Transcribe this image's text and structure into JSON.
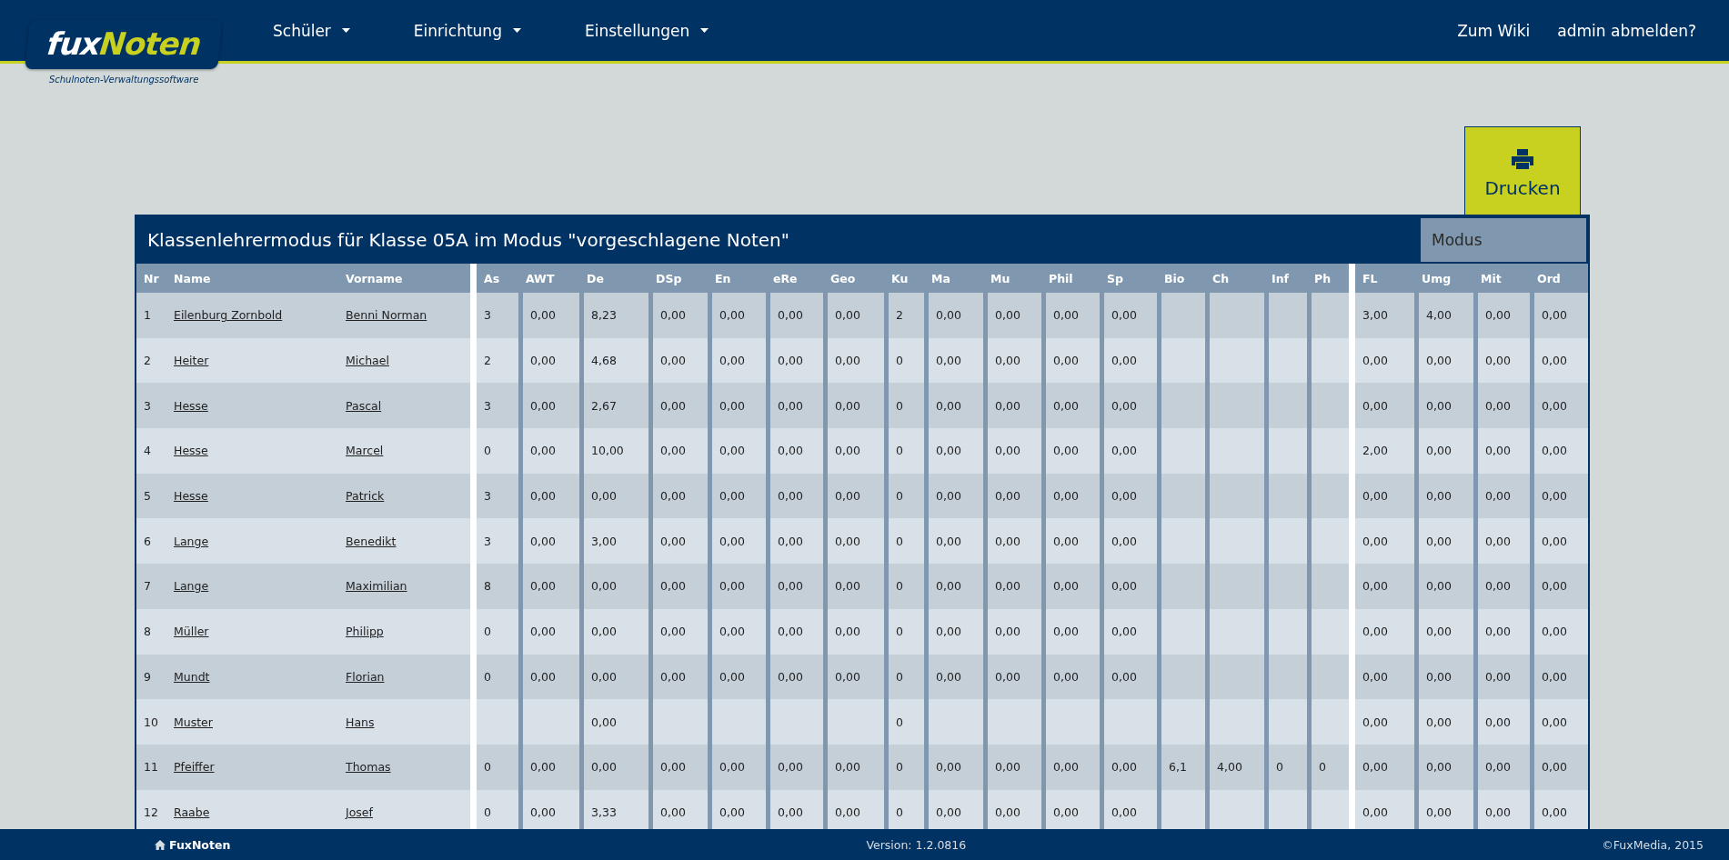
{
  "header": {
    "logo": {
      "part_1": "fux",
      "part_2": "Noten",
      "tagline": "Schulnoten-Verwaltungssoftware"
    },
    "nav": [
      {
        "label": "Schüler"
      },
      {
        "label": "Einrichtung"
      },
      {
        "label": "Einstellungen"
      }
    ],
    "links": [
      {
        "label": "Zum Wiki"
      },
      {
        "label": "admin abmelden?"
      }
    ]
  },
  "print_button": {
    "label": "Drucken"
  },
  "table": {
    "title": "Klassenlehrermodus für Klasse 05A im Modus \"vorgeschlagene Noten\"",
    "mode_dropdown": "Modus",
    "columns": {
      "student": [
        "Nr",
        "Name",
        "Vorname"
      ],
      "subjects": [
        "As",
        "AWT",
        "De",
        "DSp",
        "En",
        "eRe",
        "Geo",
        "Ku",
        "Ma",
        "Mu",
        "Phil",
        "Sp",
        "Bio",
        "Ch",
        "Inf",
        "Ph"
      ],
      "conduct": [
        "FL",
        "Umg",
        "Mit",
        "Ord"
      ]
    },
    "rows": [
      {
        "nr": "1",
        "name": "Eilenburg Zornbold",
        "first_name": "Benni Norman",
        "subjects": [
          {
            "kind": "grade",
            "value": "3"
          },
          {
            "kind": "grade",
            "value": "0,00"
          },
          {
            "kind": "grade",
            "value": "8,23"
          },
          {
            "kind": "grade",
            "value": "0,00"
          },
          {
            "kind": "grade",
            "value": "0,00"
          },
          {
            "kind": "grade",
            "value": "0,00"
          },
          {
            "kind": "grade",
            "value": "0,00"
          },
          {
            "kind": "grade",
            "value": "2"
          },
          {
            "kind": "grade",
            "value": "0,00"
          },
          {
            "kind": "grade",
            "value": "0,00"
          },
          {
            "kind": "grade",
            "value": "0,00"
          },
          {
            "kind": "grade",
            "value": "0,00"
          },
          {
            "kind": "empty"
          },
          {
            "kind": "empty"
          },
          {
            "kind": "empty"
          },
          {
            "kind": "empty"
          }
        ],
        "conduct": [
          {
            "kind": "grade",
            "value": "3,00"
          },
          {
            "kind": "grade",
            "value": "4,00"
          },
          {
            "kind": "grade",
            "value": "0,00"
          },
          {
            "kind": "grade",
            "value": "0,00"
          }
        ]
      },
      {
        "nr": "2",
        "name": "Heiter",
        "first_name": "Michael",
        "subjects": [
          {
            "kind": "grade",
            "value": "2"
          },
          {
            "kind": "grade",
            "value": "0,00"
          },
          {
            "kind": "grade",
            "value": "4,68"
          },
          {
            "kind": "grade",
            "value": "0,00"
          },
          {
            "kind": "grade",
            "value": "0,00"
          },
          {
            "kind": "grade",
            "value": "0,00"
          },
          {
            "kind": "grade",
            "value": "0,00"
          },
          {
            "kind": "grade",
            "value": "0"
          },
          {
            "kind": "grade",
            "value": "0,00"
          },
          {
            "kind": "grade",
            "value": "0,00"
          },
          {
            "kind": "grade",
            "value": "0,00"
          },
          {
            "kind": "grade",
            "value": "0,00"
          },
          {
            "kind": "empty"
          },
          {
            "kind": "empty"
          },
          {
            "kind": "empty"
          },
          {
            "kind": "empty"
          }
        ],
        "conduct": [
          {
            "kind": "grade",
            "value": "0,00"
          },
          {
            "kind": "grade",
            "value": "0,00"
          },
          {
            "kind": "grade",
            "value": "0,00"
          },
          {
            "kind": "grade",
            "value": "0,00"
          }
        ]
      },
      {
        "nr": "3",
        "name": "Hesse",
        "first_name": "Pascal",
        "subjects": [
          {
            "kind": "grade",
            "value": "3"
          },
          {
            "kind": "grade",
            "value": "0,00"
          },
          {
            "kind": "grade",
            "value": "2,67"
          },
          {
            "kind": "grade",
            "value": "0,00"
          },
          {
            "kind": "grade",
            "value": "0,00"
          },
          {
            "kind": "grade",
            "value": "0,00"
          },
          {
            "kind": "grade",
            "value": "0,00"
          },
          {
            "kind": "grade",
            "value": "0"
          },
          {
            "kind": "grade",
            "value": "0,00"
          },
          {
            "kind": "grade",
            "value": "0,00"
          },
          {
            "kind": "grade",
            "value": "0,00"
          },
          {
            "kind": "grade",
            "value": "0,00"
          },
          {
            "kind": "empty"
          },
          {
            "kind": "empty"
          },
          {
            "kind": "empty"
          },
          {
            "kind": "empty"
          }
        ],
        "conduct": [
          {
            "kind": "grade",
            "value": "0,00"
          },
          {
            "kind": "grade",
            "value": "0,00"
          },
          {
            "kind": "grade",
            "value": "0,00"
          },
          {
            "kind": "grade",
            "value": "0,00"
          }
        ]
      },
      {
        "nr": "4",
        "name": "Hesse",
        "first_name": "Marcel",
        "subjects": [
          {
            "kind": "grade",
            "value": "0"
          },
          {
            "kind": "grade",
            "value": "0,00"
          },
          {
            "kind": "grade",
            "value": "10,00"
          },
          {
            "kind": "grade",
            "value": "0,00"
          },
          {
            "kind": "grade",
            "value": "0,00"
          },
          {
            "kind": "grade",
            "value": "0,00"
          },
          {
            "kind": "grade",
            "value": "0,00"
          },
          {
            "kind": "grade",
            "value": "0"
          },
          {
            "kind": "grade",
            "value": "0,00"
          },
          {
            "kind": "grade",
            "value": "0,00"
          },
          {
            "kind": "grade",
            "value": "0,00"
          },
          {
            "kind": "grade",
            "value": "0,00"
          },
          {
            "kind": "empty"
          },
          {
            "kind": "empty"
          },
          {
            "kind": "empty"
          },
          {
            "kind": "empty"
          }
        ],
        "conduct": [
          {
            "kind": "grade",
            "value": "2,00"
          },
          {
            "kind": "grade",
            "value": "0,00"
          },
          {
            "kind": "grade",
            "value": "0,00"
          },
          {
            "kind": "grade",
            "value": "0,00"
          }
        ]
      },
      {
        "nr": "5",
        "name": "Hesse",
        "first_name": "Patrick",
        "subjects": [
          {
            "kind": "grade",
            "value": "3"
          },
          {
            "kind": "grade",
            "value": "0,00"
          },
          {
            "kind": "grade",
            "value": "0,00"
          },
          {
            "kind": "grade",
            "value": "0,00"
          },
          {
            "kind": "grade",
            "value": "0,00"
          },
          {
            "kind": "grade",
            "value": "0,00"
          },
          {
            "kind": "grade",
            "value": "0,00"
          },
          {
            "kind": "grade",
            "value": "0"
          },
          {
            "kind": "grade",
            "value": "0,00"
          },
          {
            "kind": "grade",
            "value": "0,00"
          },
          {
            "kind": "grade",
            "value": "0,00"
          },
          {
            "kind": "grade",
            "value": "0,00"
          },
          {
            "kind": "empty"
          },
          {
            "kind": "empty"
          },
          {
            "kind": "empty"
          },
          {
            "kind": "empty"
          }
        ],
        "conduct": [
          {
            "kind": "grade",
            "value": "0,00"
          },
          {
            "kind": "grade",
            "value": "0,00"
          },
          {
            "kind": "grade",
            "value": "0,00"
          },
          {
            "kind": "grade",
            "value": "0,00"
          }
        ]
      },
      {
        "nr": "6",
        "name": "Lange",
        "first_name": "Benedikt",
        "subjects": [
          {
            "kind": "grade",
            "value": "3"
          },
          {
            "kind": "grade",
            "value": "0,00"
          },
          {
            "kind": "grade",
            "value": "3,00"
          },
          {
            "kind": "grade",
            "value": "0,00"
          },
          {
            "kind": "grade",
            "value": "0,00"
          },
          {
            "kind": "grade",
            "value": "0,00"
          },
          {
            "kind": "grade",
            "value": "0,00"
          },
          {
            "kind": "grade",
            "value": "0"
          },
          {
            "kind": "grade",
            "value": "0,00"
          },
          {
            "kind": "grade",
            "value": "0,00"
          },
          {
            "kind": "grade",
            "value": "0,00"
          },
          {
            "kind": "grade",
            "value": "0,00"
          },
          {
            "kind": "empty"
          },
          {
            "kind": "empty"
          },
          {
            "kind": "empty"
          },
          {
            "kind": "empty"
          }
        ],
        "conduct": [
          {
            "kind": "grade",
            "value": "0,00"
          },
          {
            "kind": "grade",
            "value": "0,00"
          },
          {
            "kind": "grade",
            "value": "0,00"
          },
          {
            "kind": "grade",
            "value": "0,00"
          }
        ]
      },
      {
        "nr": "7",
        "name": "Lange",
        "first_name": "Maximilian",
        "subjects": [
          {
            "kind": "grade",
            "value": "8"
          },
          {
            "kind": "grade",
            "value": "0,00"
          },
          {
            "kind": "grade",
            "value": "0,00"
          },
          {
            "kind": "grade",
            "value": "0,00"
          },
          {
            "kind": "grade",
            "value": "0,00"
          },
          {
            "kind": "grade",
            "value": "0,00"
          },
          {
            "kind": "grade",
            "value": "0,00"
          },
          {
            "kind": "grade",
            "value": "0"
          },
          {
            "kind": "grade",
            "value": "0,00"
          },
          {
            "kind": "grade",
            "value": "0,00"
          },
          {
            "kind": "grade",
            "value": "0,00"
          },
          {
            "kind": "grade",
            "value": "0,00"
          },
          {
            "kind": "empty"
          },
          {
            "kind": "empty"
          },
          {
            "kind": "empty"
          },
          {
            "kind": "empty"
          }
        ],
        "conduct": [
          {
            "kind": "grade",
            "value": "0,00"
          },
          {
            "kind": "grade",
            "value": "0,00"
          },
          {
            "kind": "grade",
            "value": "0,00"
          },
          {
            "kind": "grade",
            "value": "0,00"
          }
        ]
      },
      {
        "nr": "8",
        "name": "Müller",
        "first_name": "Philipp",
        "subjects": [
          {
            "kind": "grade",
            "value": "0"
          },
          {
            "kind": "grade",
            "value": "0,00"
          },
          {
            "kind": "grade",
            "value": "0,00"
          },
          {
            "kind": "grade",
            "value": "0,00"
          },
          {
            "kind": "grade",
            "value": "0,00"
          },
          {
            "kind": "grade",
            "value": "0,00"
          },
          {
            "kind": "grade",
            "value": "0,00"
          },
          {
            "kind": "grade",
            "value": "0"
          },
          {
            "kind": "grade",
            "value": "0,00"
          },
          {
            "kind": "grade",
            "value": "0,00"
          },
          {
            "kind": "grade",
            "value": "0,00"
          },
          {
            "kind": "grade",
            "value": "0,00"
          },
          {
            "kind": "empty"
          },
          {
            "kind": "empty"
          },
          {
            "kind": "empty"
          },
          {
            "kind": "empty"
          }
        ],
        "conduct": [
          {
            "kind": "grade",
            "value": "0,00"
          },
          {
            "kind": "grade",
            "value": "0,00"
          },
          {
            "kind": "grade",
            "value": "0,00"
          },
          {
            "kind": "grade",
            "value": "0,00"
          }
        ]
      },
      {
        "nr": "9",
        "name": "Mundt",
        "first_name": "Florian",
        "subjects": [
          {
            "kind": "grade",
            "value": "0"
          },
          {
            "kind": "grade",
            "value": "0,00"
          },
          {
            "kind": "grade",
            "value": "0,00"
          },
          {
            "kind": "grade",
            "value": "0,00"
          },
          {
            "kind": "grade",
            "value": "0,00"
          },
          {
            "kind": "grade",
            "value": "0,00"
          },
          {
            "kind": "grade",
            "value": "0,00"
          },
          {
            "kind": "grade",
            "value": "0"
          },
          {
            "kind": "grade",
            "value": "0,00"
          },
          {
            "kind": "grade",
            "value": "0,00"
          },
          {
            "kind": "grade",
            "value": "0,00"
          },
          {
            "kind": "grade",
            "value": "0,00"
          },
          {
            "kind": "empty"
          },
          {
            "kind": "empty"
          },
          {
            "kind": "empty"
          },
          {
            "kind": "empty"
          }
        ],
        "conduct": [
          {
            "kind": "grade",
            "value": "0,00"
          },
          {
            "kind": "grade",
            "value": "0,00"
          },
          {
            "kind": "grade",
            "value": "0,00"
          },
          {
            "kind": "grade",
            "value": "0,00"
          }
        ]
      },
      {
        "nr": "10",
        "name": "Muster",
        "first_name": "Hans",
        "subjects": [
          {
            "kind": "empty"
          },
          {
            "kind": "empty"
          },
          {
            "kind": "grade",
            "value": "0,00"
          },
          {
            "kind": "empty"
          },
          {
            "kind": "empty"
          },
          {
            "kind": "empty"
          },
          {
            "kind": "empty"
          },
          {
            "kind": "grade",
            "value": "0"
          },
          {
            "kind": "empty"
          },
          {
            "kind": "empty"
          },
          {
            "kind": "empty"
          },
          {
            "kind": "empty"
          },
          {
            "kind": "empty"
          },
          {
            "kind": "empty"
          },
          {
            "kind": "empty"
          },
          {
            "kind": "empty"
          }
        ],
        "conduct": [
          {
            "kind": "grade",
            "value": "0,00"
          },
          {
            "kind": "grade",
            "value": "0,00"
          },
          {
            "kind": "grade",
            "value": "0,00"
          },
          {
            "kind": "grade",
            "value": "0,00"
          }
        ]
      },
      {
        "nr": "11",
        "name": "Pfeiffer",
        "first_name": "Thomas",
        "subjects": [
          {
            "kind": "grade",
            "value": "0"
          },
          {
            "kind": "grade",
            "value": "0,00"
          },
          {
            "kind": "grade",
            "value": "0,00"
          },
          {
            "kind": "grade",
            "value": "0,00"
          },
          {
            "kind": "grade",
            "value": "0,00"
          },
          {
            "kind": "grade",
            "value": "0,00"
          },
          {
            "kind": "grade",
            "value": "0,00"
          },
          {
            "kind": "grade",
            "value": "0"
          },
          {
            "kind": "grade",
            "value": "0,00"
          },
          {
            "kind": "grade",
            "value": "0,00"
          },
          {
            "kind": "grade",
            "value": "0,00"
          },
          {
            "kind": "grade",
            "value": "0,00"
          },
          {
            "kind": "grade",
            "value": "6,1"
          },
          {
            "kind": "grade",
            "value": "4,00"
          },
          {
            "kind": "grade",
            "value": "0"
          },
          {
            "kind": "grade",
            "value": "0"
          }
        ],
        "conduct": [
          {
            "kind": "grade",
            "value": "0,00"
          },
          {
            "kind": "grade",
            "value": "0,00"
          },
          {
            "kind": "grade",
            "value": "0,00"
          },
          {
            "kind": "grade",
            "value": "0,00"
          }
        ]
      },
      {
        "nr": "12",
        "name": "Raabe",
        "first_name": "Josef",
        "subjects": [
          {
            "kind": "grade",
            "value": "0"
          },
          {
            "kind": "grade",
            "value": "0,00"
          },
          {
            "kind": "grade",
            "value": "3,33"
          },
          {
            "kind": "grade",
            "value": "0,00"
          },
          {
            "kind": "grade",
            "value": "0,00"
          },
          {
            "kind": "grade",
            "value": "0,00"
          },
          {
            "kind": "grade",
            "value": "0,00"
          },
          {
            "kind": "grade",
            "value": "0"
          },
          {
            "kind": "grade",
            "value": "0,00"
          },
          {
            "kind": "grade",
            "value": "0,00"
          },
          {
            "kind": "grade",
            "value": "0,00"
          },
          {
            "kind": "grade",
            "value": "0,00"
          },
          {
            "kind": "empty"
          },
          {
            "kind": "empty"
          },
          {
            "kind": "empty"
          },
          {
            "kind": "empty"
          }
        ],
        "conduct": [
          {
            "kind": "grade",
            "value": "0,00"
          },
          {
            "kind": "grade",
            "value": "0,00"
          },
          {
            "kind": "grade",
            "value": "0,00"
          },
          {
            "kind": "grade",
            "value": "0,00"
          }
        ]
      }
    ]
  },
  "footer": {
    "home": "FuxNoten",
    "version": "Version: 1.2.0816",
    "copyright": "©FuxMedia, 2015"
  }
}
